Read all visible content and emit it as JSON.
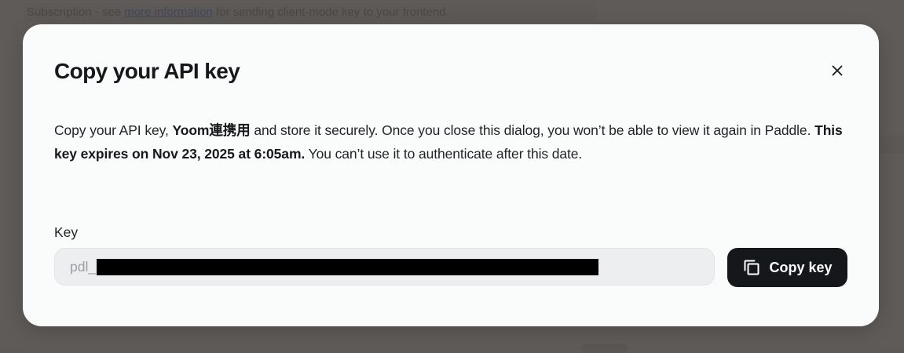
{
  "background": {
    "line_prefix": "Subscription - see",
    "line_link": "more information",
    "line_suffix": "for sending client-mode key to your frontend."
  },
  "dialog": {
    "title": "Copy your API key",
    "close_icon": "close-icon",
    "description": {
      "part1": "Copy your API key, ",
      "key_name": "Yoom連携用",
      "part2": " and store it securely. Once you close this dialog, you won’t be able to view it again in Paddle. ",
      "expiry_notice": "This key expires on Nov 23, 2025 at 6:05am.",
      "part3": " You can’t use it to authenticate after this date."
    },
    "key_field": {
      "label": "Key",
      "prefix": "pdl_",
      "value_redacted": true
    },
    "copy_button": {
      "label": "Copy key",
      "icon": "copy-icon"
    }
  },
  "colors": {
    "overlay": "#5f5b58",
    "modal_background": "#fafbfb",
    "button_background": "#14181b",
    "field_background": "#eceef0"
  }
}
